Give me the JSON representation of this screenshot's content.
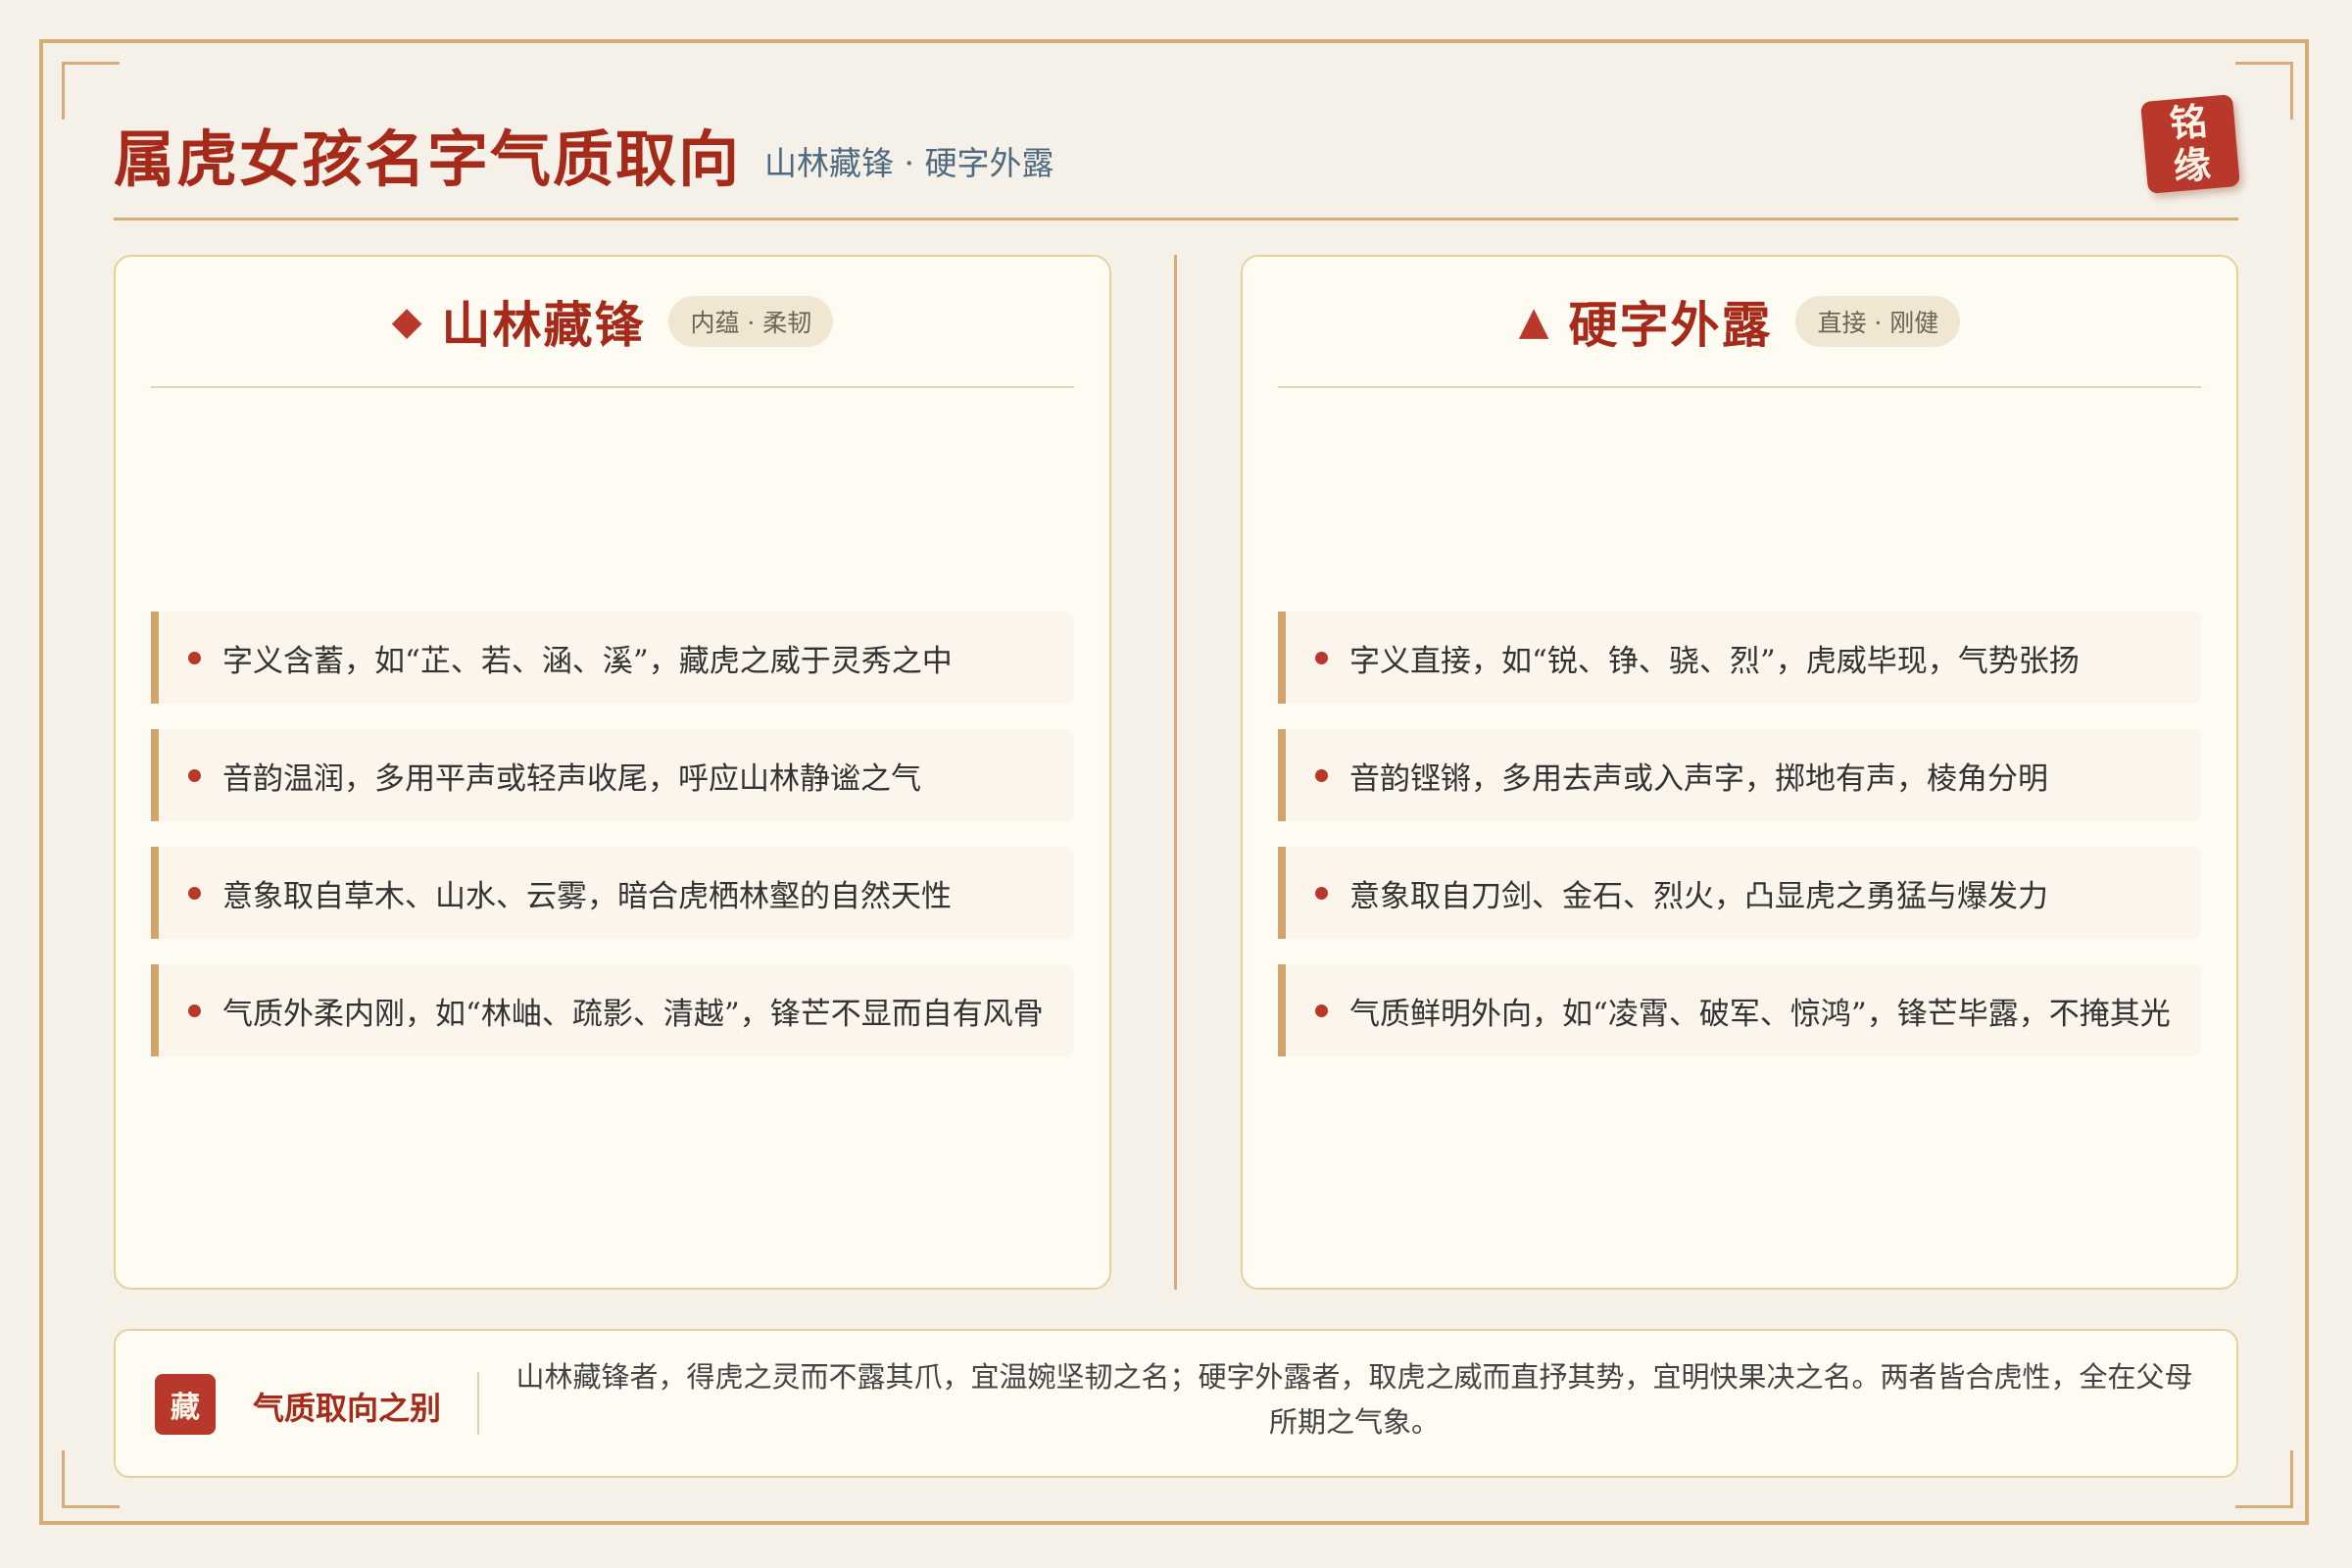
{
  "header": {
    "title": "属虎女孩名字气质取向",
    "subtitle": "山林藏锋 · 硬字外露",
    "seal": [
      "铭",
      "缘"
    ]
  },
  "left_panel": {
    "icon": "diamond-icon",
    "title": "山林藏锋",
    "badge": "内蕴 · 柔韧",
    "items": [
      "字义含蓄，如“芷、若、涵、溪”，藏虎之威于灵秀之中",
      "音韵温润，多用平声或轻声收尾，呼应山林静谧之气",
      "意象取自草木、山水、云雾，暗合虎栖林壑的自然天性",
      "气质外柔内刚，如“林岫、疏影、清越”，锋芒不显而自有风骨"
    ]
  },
  "right_panel": {
    "icon": "triangle-icon",
    "title": "硬字外露",
    "badge": "直接 · 刚健",
    "items": [
      "字义直接，如“锐、铮、骁、烈”，虎威毕现，气势张扬",
      "音韵铿锵，多用去声或入声字，掷地有声，棱角分明",
      "意象取自刀剑、金石、烈火，凸显虎之勇猛与爆发力",
      "气质鲜明外向，如“凌霄、破军、惊鸿”，锋芒毕露，不掩其光"
    ]
  },
  "footer": {
    "badge": "藏",
    "label": "气质取向之别",
    "text": "山林藏锋者，得虎之灵而不露其爪，宜温婉坚韧之名；硬字外露者，取虎之威而直抒其势，宜明快果决之名。两者皆合虎性，全在父母所期之气象。"
  },
  "colors": {
    "accent": "#a52a1a",
    "seal": "#b8392b",
    "border": "#d6ad75",
    "subtitle": "#4d6a80"
  }
}
